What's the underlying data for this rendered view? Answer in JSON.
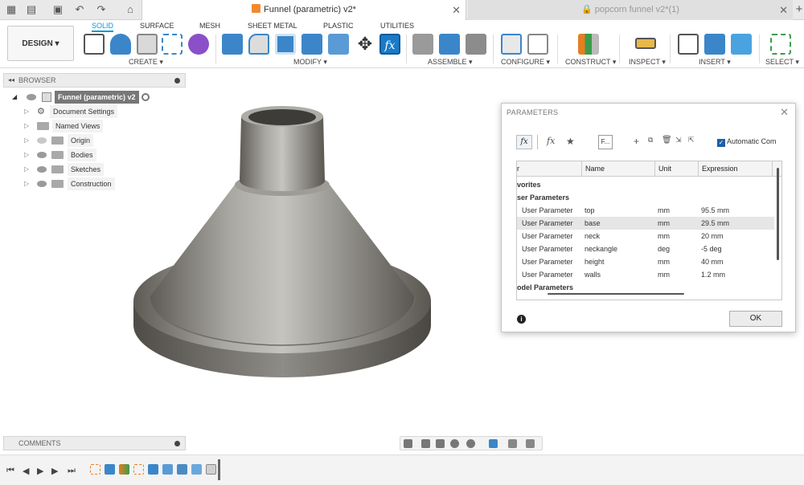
{
  "tabs": {
    "active": "Funnel (parametric) v2*",
    "inactive": "popcorn funnel v2*(1)"
  },
  "toolbar": {
    "design_label": "DESIGN",
    "workspace_tabs": [
      "SOLID",
      "SURFACE",
      "MESH",
      "SHEET METAL",
      "PLASTIC",
      "UTILITIES"
    ],
    "groups": [
      "CREATE",
      "MODIFY",
      "ASSEMBLE",
      "CONFIGURE",
      "CONSTRUCT",
      "INSPECT",
      "INSERT",
      "SELECT"
    ]
  },
  "browser": {
    "title": "BROWSER",
    "root": "Funnel (parametric) v2",
    "items": [
      {
        "label": "Document Settings"
      },
      {
        "label": "Named Views"
      },
      {
        "label": "Origin"
      },
      {
        "label": "Bodies"
      },
      {
        "label": "Sketches"
      },
      {
        "label": "Construction"
      }
    ]
  },
  "comments": {
    "title": "COMMENTS"
  },
  "parameters": {
    "title": "PARAMETERS",
    "fx_label": "fx",
    "filter_label": "F...",
    "automatic_label": "Automatic Com",
    "columns": [
      "r",
      "Name",
      "Unit",
      "Expression"
    ],
    "sections": [
      "vorites",
      "ser Parameters",
      "odel Parameters"
    ],
    "rows": [
      {
        "type": "User Parameter",
        "name": "top",
        "unit": "mm",
        "expression": "95.5 mm"
      },
      {
        "type": "User Parameter",
        "name": "base",
        "unit": "mm",
        "expression": "29.5 mm"
      },
      {
        "type": "User Parameter",
        "name": "neck",
        "unit": "mm",
        "expression": "20 mm"
      },
      {
        "type": "User Parameter",
        "name": "neckangle",
        "unit": "deg",
        "expression": "-5 deg"
      },
      {
        "type": "User Parameter",
        "name": "height",
        "unit": "mm",
        "expression": "40 mm"
      },
      {
        "type": "User Parameter",
        "name": "walls",
        "unit": "mm",
        "expression": "1.2 mm"
      }
    ],
    "ok_label": "OK"
  },
  "colors": {
    "accent": "#0696d7",
    "metal": "#8c8a86"
  }
}
